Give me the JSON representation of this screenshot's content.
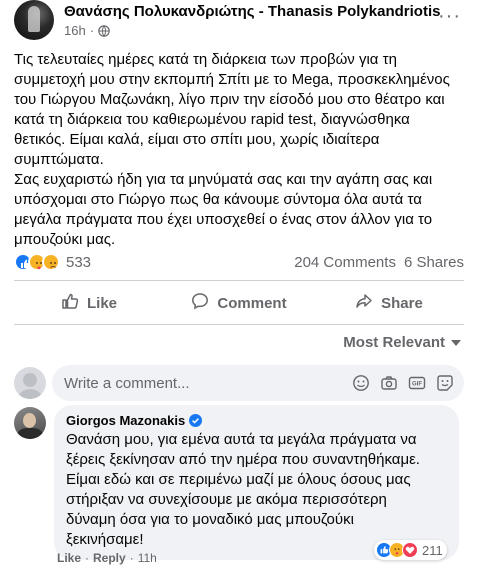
{
  "post": {
    "author": "Θανάσης Πολυκανδριώτης - Thanasis Polykandriotis",
    "time": "16h",
    "separator": "·",
    "more_label": "···",
    "text_lines": [
      "Τις τελευταίες ημέρες κατά τη διάρκεια των προβών για τη",
      "συμμετοχή μου στην εκπομπή Σπίτι με το Mega, προσκεκλημένος",
      "του Γιώργου Μαζωνάκη, λίγο πριν την είσοδό μου στο θέατρο και",
      "κατά τη διάρκεια του καθιερωμένου rapid test, διαγνώσθηκα",
      "θετικός. Είμαι καλά, είμαι στο σπίτι μου, χωρίς ιδιαίτερα",
      "συμπτώματα.",
      "Σας ευχαριστώ ήδη για τα μηνύματά σας και την αγάπη σας και",
      "υπόσχομαι στο Γιώργο πως θα κάνουμε σύντομα όλα αυτά τα",
      "μεγάλα πράγματα που έχει υποσχεθεί ο ένας στον άλλον για το",
      "μπουζούκι μας."
    ]
  },
  "stats": {
    "reactions_count": "533",
    "comments": "204 Comments",
    "shares": "6 Shares"
  },
  "actions": {
    "like": "Like",
    "comment": "Comment",
    "share": "Share"
  },
  "sort": {
    "label": "Most Relevant"
  },
  "composer": {
    "placeholder": "Write a comment..."
  },
  "comment": {
    "author": "Giorgos Mazonakis",
    "text_lines": [
      "Θανάση μου, για εμένα αυτά τα μεγάλα πράγματα να",
      "ξέρεις ξεκίνησαν από την ημέρα που συναντηθήκαμε.",
      "Είμαι εδώ και σε περιμένω μαζί με όλους όσους μας",
      "στήριξαν να συνεχίσουμε με ακόμα περισσότερη",
      "δύναμη όσα για το μοναδικό μας μπουζούκι",
      "ξεκινήσαμε!"
    ],
    "like_label": "Like",
    "reply_label": "Reply",
    "time": "11h",
    "separator": "·",
    "reactions_count": "211"
  },
  "colors": {
    "facebook_blue": "#1877f2",
    "secondary_text": "#65676b",
    "bubble_bg": "#f0f2f5"
  },
  "icons": [
    "globe-icon",
    "more-icon",
    "like-reaction-icon",
    "love-reaction-icon",
    "care-reaction-icon",
    "sad-reaction-icon",
    "like-icon",
    "comment-icon",
    "share-icon",
    "chevron-down-icon",
    "smiley-icon",
    "camera-icon",
    "gif-icon",
    "sticker-icon",
    "verified-icon"
  ]
}
